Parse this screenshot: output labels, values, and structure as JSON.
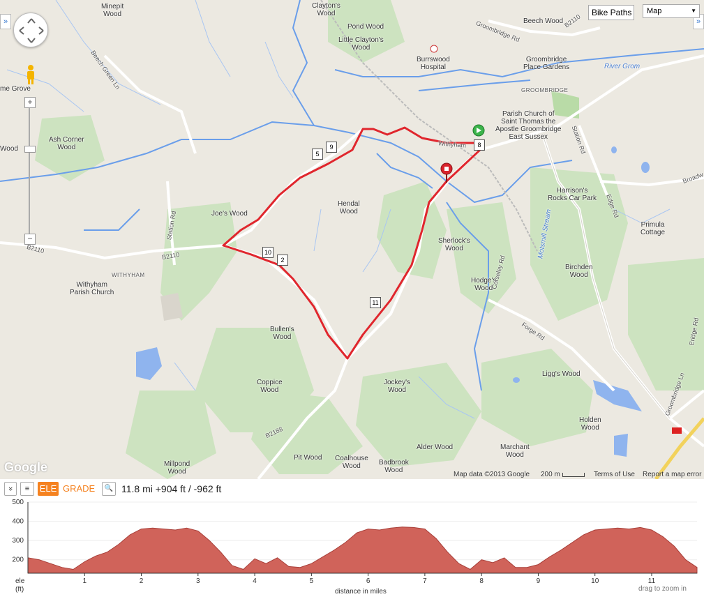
{
  "map": {
    "labels": [
      {
        "id": "minepit-wood",
        "text": "Minepit\nWood"
      },
      {
        "id": "claytons-wood",
        "text": "Clayton's\nWood"
      },
      {
        "id": "pond-wood",
        "text": "Pond Wood"
      },
      {
        "id": "little-claytons-wood",
        "text": "Little Clayton's\nWood"
      },
      {
        "id": "burrswood-hospital",
        "text": "Burrswood\nHospital"
      },
      {
        "id": "groombridge-rd",
        "text": "Groombridge Rd"
      },
      {
        "id": "beech-wood",
        "text": "Beech Wood"
      },
      {
        "id": "groombridge-place",
        "text": "Groombridge\nPlace Gardens"
      },
      {
        "id": "river-grom",
        "text": "River Grom"
      },
      {
        "id": "groombridge",
        "text": "GROOMBRIDGE"
      },
      {
        "id": "parish-church-st-thomas",
        "text": "Parish Church of\nSaint Thomas the\nApostle Groombridge\nEast Sussex"
      },
      {
        "id": "station-rd-right",
        "text": "Station Rd"
      },
      {
        "id": "broadwater",
        "text": "Broadw"
      },
      {
        "id": "harrisons-rocks",
        "text": "Harrison's\nRocks Car Park"
      },
      {
        "id": "edge-rd",
        "text": "Edge Rd"
      },
      {
        "id": "primula-cottage",
        "text": "Primula\nCottage"
      },
      {
        "id": "birchden-wood",
        "text": "Birchden\nWood"
      },
      {
        "id": "ligg-s-wood",
        "text": "Ligg's Wood"
      },
      {
        "id": "holden-wood",
        "text": "Holden\nWood"
      },
      {
        "id": "marchant-wood",
        "text": "Marchant\nWood"
      },
      {
        "id": "alder-wood",
        "text": "Alder Wood"
      },
      {
        "id": "badbrook-wood",
        "text": "Badbrook\nWood"
      },
      {
        "id": "coalhouse-wood",
        "text": "Coalhouse\nWood"
      },
      {
        "id": "pit-wood",
        "text": "Pit Wood"
      },
      {
        "id": "millpond-wood",
        "text": "Millpond\nWood"
      },
      {
        "id": "b2188-bottom",
        "text": "B2188"
      },
      {
        "id": "jockeys-wood",
        "text": "Jockey's\nWood"
      },
      {
        "id": "coppice-wood",
        "text": "Coppice\nWood"
      },
      {
        "id": "bullens-wood",
        "text": "Bullen's\nWood"
      },
      {
        "id": "hodges-wood",
        "text": "Hodge's\nWood"
      },
      {
        "id": "sherlocks-wood",
        "text": "Sherlock's\nWood"
      },
      {
        "id": "hendal-wood",
        "text": "Hendal\nWood"
      },
      {
        "id": "joes-wood",
        "text": "Joe's Wood"
      },
      {
        "id": "ash-corner-wood",
        "text": "Ash Corner\nWood"
      },
      {
        "id": "beech-green-ln",
        "text": "Beech Green Ln"
      },
      {
        "id": "station-rd-left",
        "text": "Station Rd"
      },
      {
        "id": "withyham",
        "text": "WITHYHAM"
      },
      {
        "id": "withyham-parish-church",
        "text": "Withyham\nParish Church"
      },
      {
        "id": "b2110-left",
        "text": "B2110"
      },
      {
        "id": "b2110-mid",
        "text": "B2110"
      },
      {
        "id": "b2110-top",
        "text": "B2110"
      },
      {
        "id": "home-grove",
        "text": "me Grove"
      },
      {
        "id": "wood-left",
        "text": "Wood"
      },
      {
        "id": "corseley-rd",
        "text": "Corseley Rd"
      },
      {
        "id": "forge-rd",
        "text": "Forge Rd"
      },
      {
        "id": "groombridge-ln",
        "text": "Groombridge Ln"
      },
      {
        "id": "eridge-rd",
        "text": "Eridge Rd"
      },
      {
        "id": "motsmill-stream",
        "text": "Motsmill Stream"
      },
      {
        "id": "withyham-rd",
        "text": "Withyham"
      }
    ],
    "markers": [
      "9",
      "8",
      "10",
      "11",
      "5",
      "2"
    ],
    "controls": {
      "bike_paths": "Bike Paths",
      "map_type": "Map",
      "zoom_in": "+",
      "zoom_out": "−",
      "toggle_left": "»",
      "toggle_right": "»"
    },
    "attribution": {
      "logo": "Google",
      "map_data": "Map data ©2013 Google",
      "scale": "200 m",
      "terms": "Terms of Use",
      "report": "Report a map error"
    }
  },
  "profile": {
    "collapse_label": "»",
    "menu_label": "≡",
    "tab_ele": "ELE",
    "tab_grade": "GRADE",
    "zoom_label": "🔍",
    "summary": "11.8 mi +904 ft / -962 ft",
    "ylabel": "ele\n(ft)",
    "xlabel": "distance in miles",
    "hint": "drag to zoom in",
    "colors": {
      "fill": "#d0635a",
      "accent": "#f58220"
    }
  },
  "chart_data": {
    "type": "area",
    "xlabel": "distance in miles",
    "ylabel": "ele (ft)",
    "xlim": [
      0,
      11.8
    ],
    "ylim": [
      130,
      500
    ],
    "yticks": [
      200,
      300,
      400,
      500
    ],
    "xticks": [
      1,
      2,
      3,
      4,
      5,
      6,
      7,
      8,
      9,
      10,
      11
    ],
    "x": [
      0,
      0.2,
      0.4,
      0.6,
      0.8,
      1.0,
      1.2,
      1.4,
      1.6,
      1.8,
      2.0,
      2.2,
      2.4,
      2.6,
      2.8,
      3.0,
      3.2,
      3.4,
      3.6,
      3.8,
      4.0,
      4.2,
      4.4,
      4.6,
      4.8,
      5.0,
      5.2,
      5.4,
      5.6,
      5.8,
      6.0,
      6.2,
      6.4,
      6.6,
      6.8,
      7.0,
      7.2,
      7.4,
      7.6,
      7.8,
      8.0,
      8.2,
      8.4,
      8.6,
      8.8,
      9.0,
      9.2,
      9.4,
      9.6,
      9.8,
      10.0,
      10.2,
      10.4,
      10.6,
      10.8,
      11.0,
      11.2,
      11.4,
      11.6,
      11.8
    ],
    "y": [
      210,
      200,
      180,
      160,
      150,
      190,
      220,
      240,
      280,
      330,
      360,
      365,
      360,
      355,
      365,
      350,
      300,
      240,
      170,
      150,
      205,
      180,
      210,
      165,
      160,
      180,
      215,
      250,
      290,
      340,
      360,
      355,
      365,
      370,
      368,
      360,
      310,
      240,
      180,
      150,
      200,
      185,
      210,
      160,
      160,
      175,
      215,
      250,
      290,
      330,
      355,
      360,
      365,
      360,
      368,
      355,
      320,
      270,
      200,
      160
    ]
  }
}
